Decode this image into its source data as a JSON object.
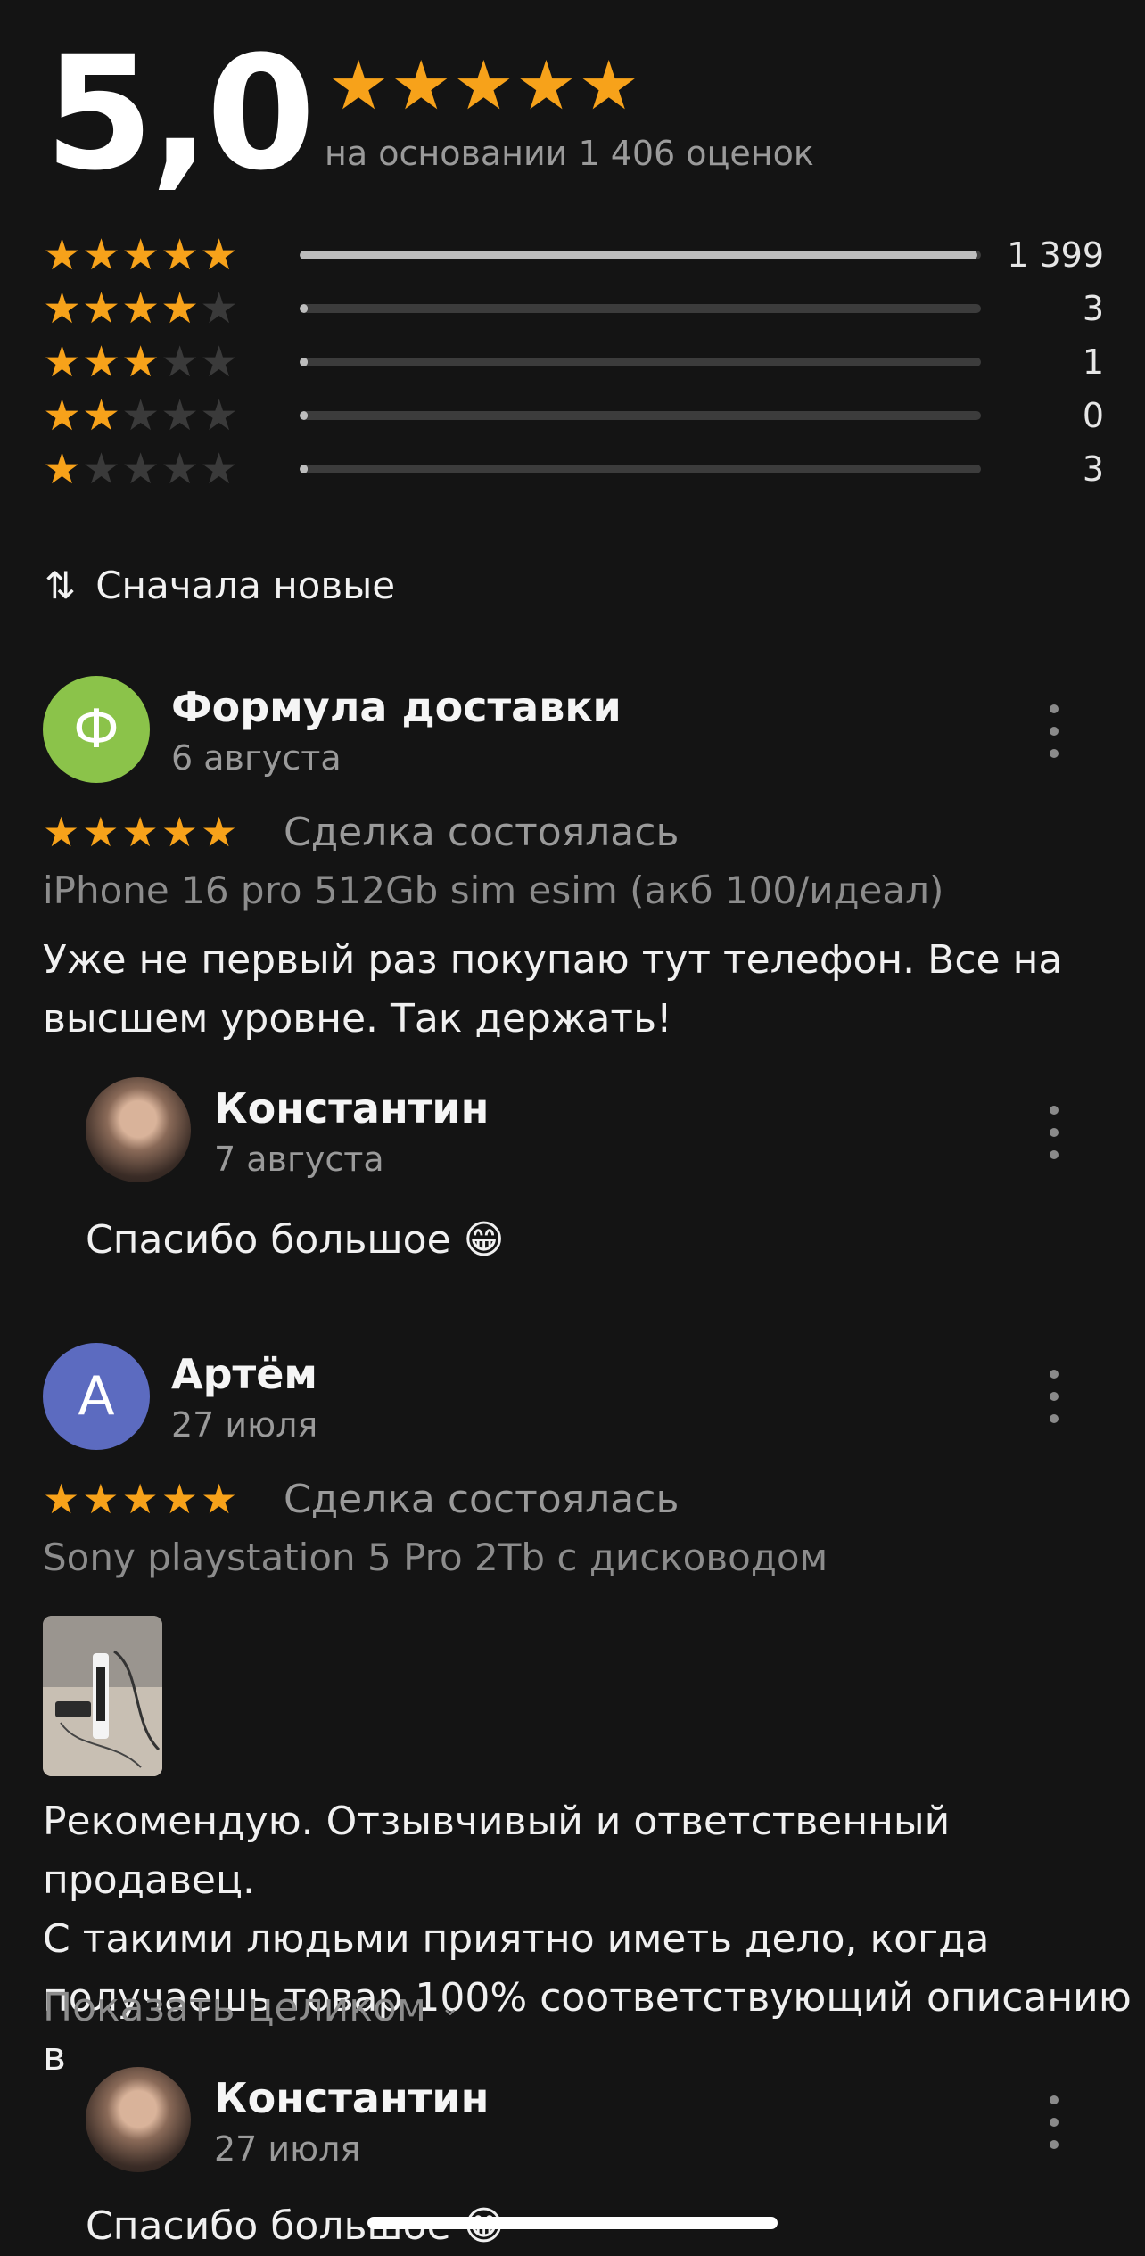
{
  "summary": {
    "score": "5,0",
    "stars": 5,
    "based_on": "на основании 1 406 оценок"
  },
  "histogram": [
    {
      "stars": 5,
      "count": "1 399",
      "fraction": 0.995
    },
    {
      "stars": 4,
      "count": "3",
      "fraction": 0.01
    },
    {
      "stars": 3,
      "count": "1",
      "fraction": 0.01
    },
    {
      "stars": 2,
      "count": "0",
      "fraction": 0.0
    },
    {
      "stars": 1,
      "count": "3",
      "fraction": 0.01
    }
  ],
  "sort": {
    "icon": "sort-arrows-icon",
    "label": "Сначала новые"
  },
  "reviews": [
    {
      "author": "Формула доставки",
      "avatar_letter": "Ф",
      "avatar_color": "#8bc34a",
      "date": "6 августа",
      "rating": 5,
      "status": "Сделка состоялась",
      "product": "iPhone 16 pro 512Gb sim esim (акб 100/идеал)",
      "text_line1": "Уже не первый раз покупаю тут телефон. Все на",
      "text_line2": "высшем уровне. Так держать!",
      "reply": {
        "author": "Константин",
        "date": "7 августа",
        "text": "Спасибо большое 😁"
      }
    },
    {
      "author": "Артём",
      "avatar_letter": "А",
      "avatar_color": "#5c6bc0",
      "date": "27 июля",
      "rating": 5,
      "status": "Сделка состоялась",
      "product": "Sony playstation 5 Pro 2Tb с дисководом",
      "text_line1": "Рекомендую. Отзывчивый и ответственный продавец.",
      "text_line2": "С такими людьми приятно иметь дело, когда",
      "text_line3": "получаешь товар 100% соответствующий описанию в",
      "show_more": "Показать целиком",
      "reply": {
        "author": "Константин",
        "date": "27 июля",
        "text": "Спасибо большое 😁"
      }
    }
  ],
  "colors": {
    "star": "#f7a21a",
    "background": "#141414"
  }
}
